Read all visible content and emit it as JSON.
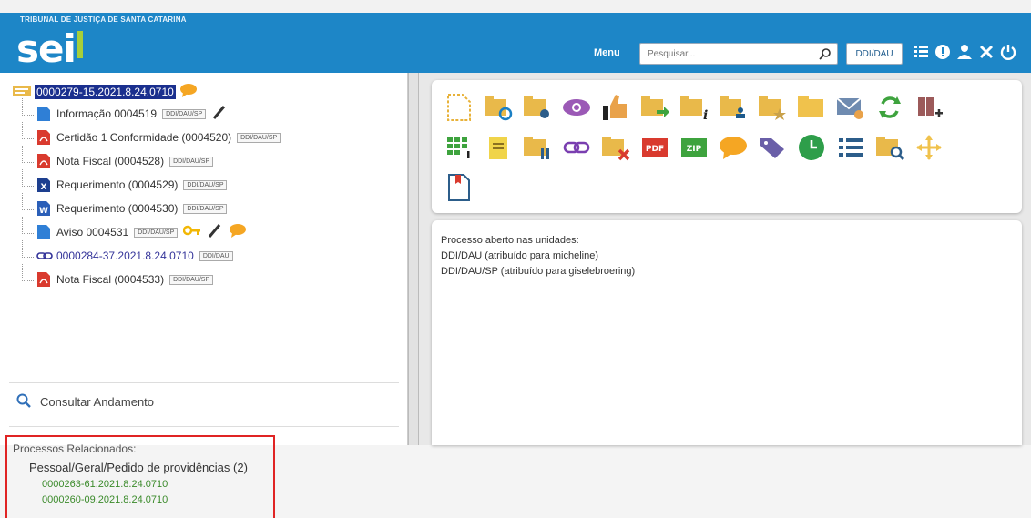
{
  "header": {
    "tribunal": "TRIBUNAL DE JUSTIÇA DE SANTA CATARINA",
    "logo": "sei",
    "menu_label": "Menu",
    "search_placeholder": "Pesquisar...",
    "unit": "DDI/DAU"
  },
  "tree": {
    "root_number": "0000279-15.2021.8.24.0710",
    "items": [
      {
        "label": "Informação 0004519",
        "tag": "DDI/DAU/SP",
        "icon": "doc-blue-icon"
      },
      {
        "label": "Certidão 1 Conformidade (0004520)",
        "tag": "DDI/DAU/SP",
        "icon": "pdf-icon"
      },
      {
        "label": "Nota Fiscal (0004528)",
        "tag": "DDI/DAU/SP",
        "icon": "pdf-icon"
      },
      {
        "label": "Requerimento (0004529)",
        "tag": "DDI/DAU/SP",
        "icon": "excel-icon"
      },
      {
        "label": "Requerimento (0004530)",
        "tag": "DDI/DAU/SP",
        "icon": "word-icon"
      },
      {
        "label": "Aviso 0004531",
        "tag": "DDI/DAU/SP",
        "icon": "doc-blue-icon"
      },
      {
        "label": "0000284-37.2021.8.24.0710",
        "tag": "DDI/DAU",
        "icon": "link-icon"
      },
      {
        "label": "Nota Fiscal (0004533)",
        "tag": "DDI/DAU/SP",
        "icon": "pdf-icon"
      }
    ]
  },
  "consult": {
    "label": "Consultar Andamento"
  },
  "related": {
    "title": "Processos Relacionados:",
    "group": "Pessoal/Geral/Pedido de providências (2)",
    "links": [
      "0000263-61.2021.8.24.0710",
      "0000260-09.2021.8.24.0710"
    ]
  },
  "content": {
    "lines": [
      "Processo aberto nas unidades:",
      "DDI/DAU (atribuído para micheline)",
      "DDI/DAU/SP (atribuído para giselebroering)"
    ]
  },
  "colors": {
    "header_bg": "#1d86c7",
    "root_highlight": "#1a2f8e",
    "related_border": "#e02424",
    "related_link": "#3a8a2a"
  }
}
